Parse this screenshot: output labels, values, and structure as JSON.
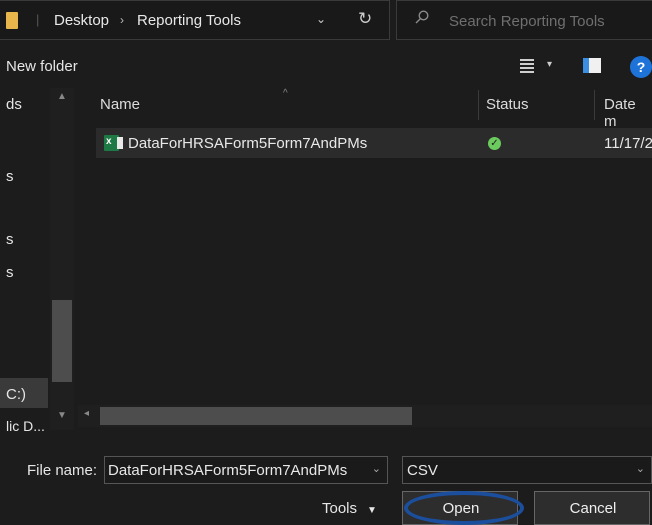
{
  "address": {
    "crumbs": [
      "Desktop",
      "Reporting Tools"
    ],
    "chevron": "›",
    "dropdown": "⌄",
    "refresh": "↻"
  },
  "search": {
    "placeholder": "Search Reporting Tools"
  },
  "toolbar": {
    "new_folder": "New folder",
    "help": "?"
  },
  "nav": {
    "items": [
      "ds",
      "s",
      "s",
      "s",
      "C:)",
      "lic D..."
    ]
  },
  "columns": {
    "name": "Name",
    "status": "Status",
    "date": "Date m"
  },
  "files": [
    {
      "icon": "excel-csv-icon",
      "icon_text": "x",
      "name": "DataForHRSAForm5Form7AndPMs",
      "status": "synced-check-icon",
      "date": "11/17/2"
    }
  ],
  "footer": {
    "file_name_label": "File name:",
    "file_name_value": "DataForHRSAForm5Form7AndPMs",
    "file_type": "CSV",
    "tools": "Tools",
    "open": "Open",
    "cancel": "Cancel"
  },
  "colors": {
    "accent": "#1e73d8",
    "status_ok": "#6ccb5f",
    "excel": "#1e7a44",
    "highlight_circle": "#1b4f9e"
  }
}
